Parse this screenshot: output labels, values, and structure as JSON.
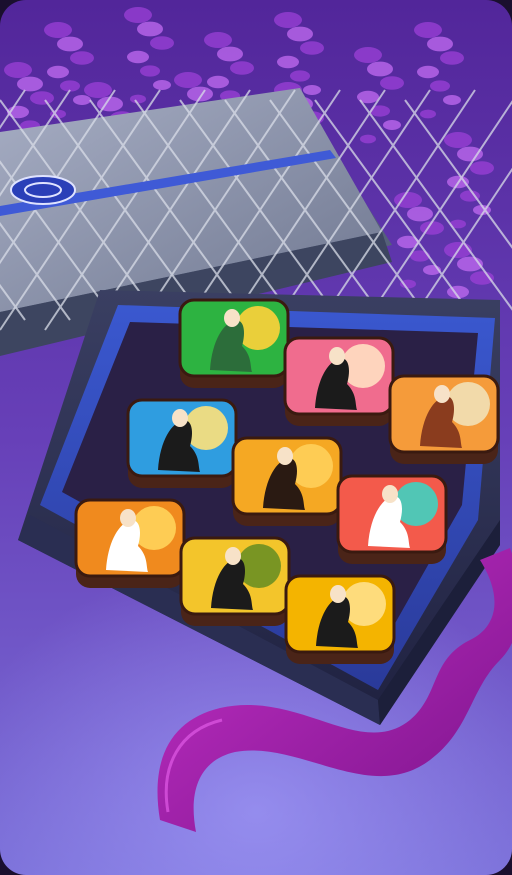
{
  "scene": {
    "colors": {
      "bg_top": "#5a2c9e",
      "bg_bottom": "#6a5fd0",
      "wisteria": "#b054e8",
      "lid": "#8f99b3",
      "box_blue": "#3b5fd6",
      "ribbon": "#a01fa8",
      "chocolate": "#4a2418"
    },
    "chocolates": [
      {
        "row": 0,
        "col": 0,
        "theme": "green-landscape",
        "colors": [
          "#2db341",
          "#ffd23a",
          "#2c6d3a"
        ]
      },
      {
        "row": 0,
        "col": 1,
        "theme": "pink-court-lady",
        "colors": [
          "#f06c8e",
          "#ffe0c2",
          "#1b1b1b"
        ]
      },
      {
        "row": 0,
        "col": 2,
        "theme": "orange-court-lady",
        "colors": [
          "#f59b3a",
          "#f2e1b7",
          "#8a3c1e"
        ]
      },
      {
        "row": 1,
        "col": 0,
        "theme": "blue-lady-back",
        "colors": [
          "#2f9de0",
          "#ffe27a",
          "#1b1b1b"
        ]
      },
      {
        "row": 1,
        "col": 1,
        "theme": "amber-lady-robe",
        "colors": [
          "#f5a823",
          "#ffcf5a",
          "#2a1a12"
        ]
      },
      {
        "row": 1,
        "col": 2,
        "theme": "coral-waves",
        "colors": [
          "#f35a4b",
          "#3fd1c1",
          "#ffffff"
        ]
      },
      {
        "row": 2,
        "col": 0,
        "theme": "orange-poet",
        "colors": [
          "#f08a1e",
          "#ffd35a",
          "#ffffff"
        ]
      },
      {
        "row": 2,
        "col": 1,
        "theme": "olive-nobleman",
        "colors": [
          "#f3c52b",
          "#6b8f22",
          "#1b1b1b"
        ]
      },
      {
        "row": 2,
        "col": 2,
        "theme": "gold-nobleman",
        "colors": [
          "#f4b400",
          "#ffe08a",
          "#1b1b1b"
        ]
      }
    ]
  }
}
